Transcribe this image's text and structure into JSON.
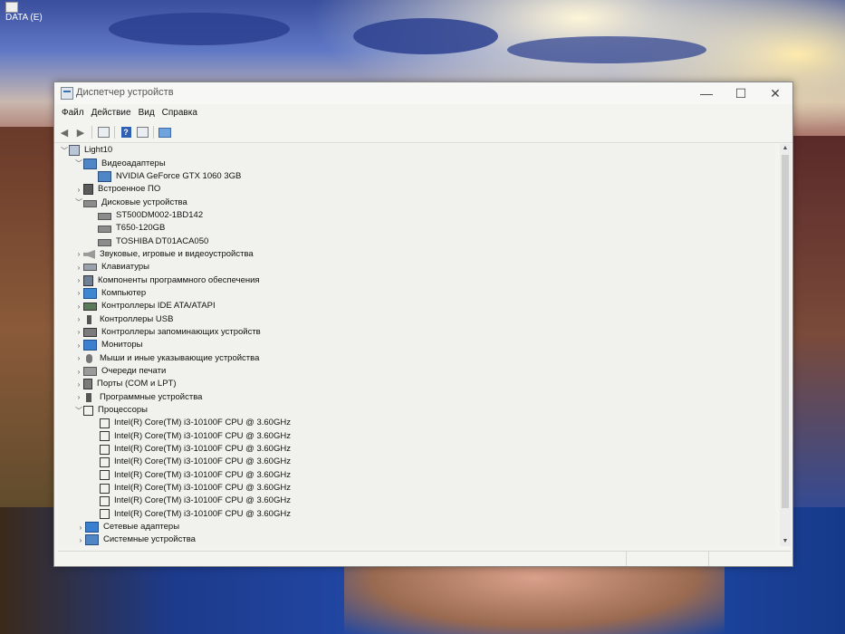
{
  "desktop": {
    "icon_label": "DATA (E)"
  },
  "window": {
    "title": "Диспетчер устройств",
    "controls": {
      "minimize": "—",
      "maximize": "☐",
      "close": "✕"
    }
  },
  "menu": [
    "Файл",
    "Действие",
    "Вид",
    "Справка"
  ],
  "toolbar": {
    "back_icon": "back-arrow-icon",
    "forward_icon": "forward-arrow-icon",
    "help_glyph": "?"
  },
  "tree": {
    "root": "Light10",
    "categories": [
      {
        "label": "Видеоадаптеры",
        "expanded": true,
        "icon": "display-adapter-icon",
        "children": [
          "NVIDIA GeForce GTX 1060 3GB"
        ]
      },
      {
        "label": "Встроенное ПО",
        "expanded": false,
        "icon": "firmware-icon"
      },
      {
        "label": "Дисковые устройства",
        "expanded": true,
        "icon": "disk-drive-icon",
        "children": [
          "ST500DM002-1BD142",
          "T650-120GB",
          "TOSHIBA DT01ACA050"
        ]
      },
      {
        "label": "Звуковые, игровые и видеоустройства",
        "expanded": false,
        "icon": "sound-icon"
      },
      {
        "label": "Клавиатуры",
        "expanded": false,
        "icon": "keyboard-icon"
      },
      {
        "label": "Компоненты программного обеспечения",
        "expanded": false,
        "icon": "software-component-icon"
      },
      {
        "label": "Компьютер",
        "expanded": false,
        "icon": "computer-icon"
      },
      {
        "label": "Контроллеры IDE ATA/ATAPI",
        "expanded": false,
        "icon": "ide-controller-icon"
      },
      {
        "label": "Контроллеры USB",
        "expanded": false,
        "icon": "usb-icon"
      },
      {
        "label": "Контроллеры запоминающих устройств",
        "expanded": false,
        "icon": "storage-controller-icon"
      },
      {
        "label": "Мониторы",
        "expanded": false,
        "icon": "monitor-icon"
      },
      {
        "label": "Мыши и иные указывающие устройства",
        "expanded": false,
        "icon": "mouse-icon"
      },
      {
        "label": "Очереди печати",
        "expanded": false,
        "icon": "printer-icon"
      },
      {
        "label": "Порты (COM и LPT)",
        "expanded": false,
        "icon": "port-icon"
      },
      {
        "label": "Программные устройства",
        "expanded": false,
        "icon": "software-device-icon"
      },
      {
        "label": "Процессоры",
        "expanded": true,
        "icon": "processor-icon",
        "children": [
          "Intel(R) Core(TM) i3-10100F CPU @ 3.60GHz",
          "Intel(R) Core(TM) i3-10100F CPU @ 3.60GHz",
          "Intel(R) Core(TM) i3-10100F CPU @ 3.60GHz",
          "Intel(R) Core(TM) i3-10100F CPU @ 3.60GHz",
          "Intel(R) Core(TM) i3-10100F CPU @ 3.60GHz",
          "Intel(R) Core(TM) i3-10100F CPU @ 3.60GHz",
          "Intel(R) Core(TM) i3-10100F CPU @ 3.60GHz",
          "Intel(R) Core(TM) i3-10100F CPU @ 3.60GHz"
        ]
      },
      {
        "label": "Сетевые адаптеры",
        "expanded": false,
        "icon": "network-adapter-icon"
      },
      {
        "label": "Системные устройства",
        "expanded": false,
        "icon": "system-device-icon"
      }
    ]
  }
}
